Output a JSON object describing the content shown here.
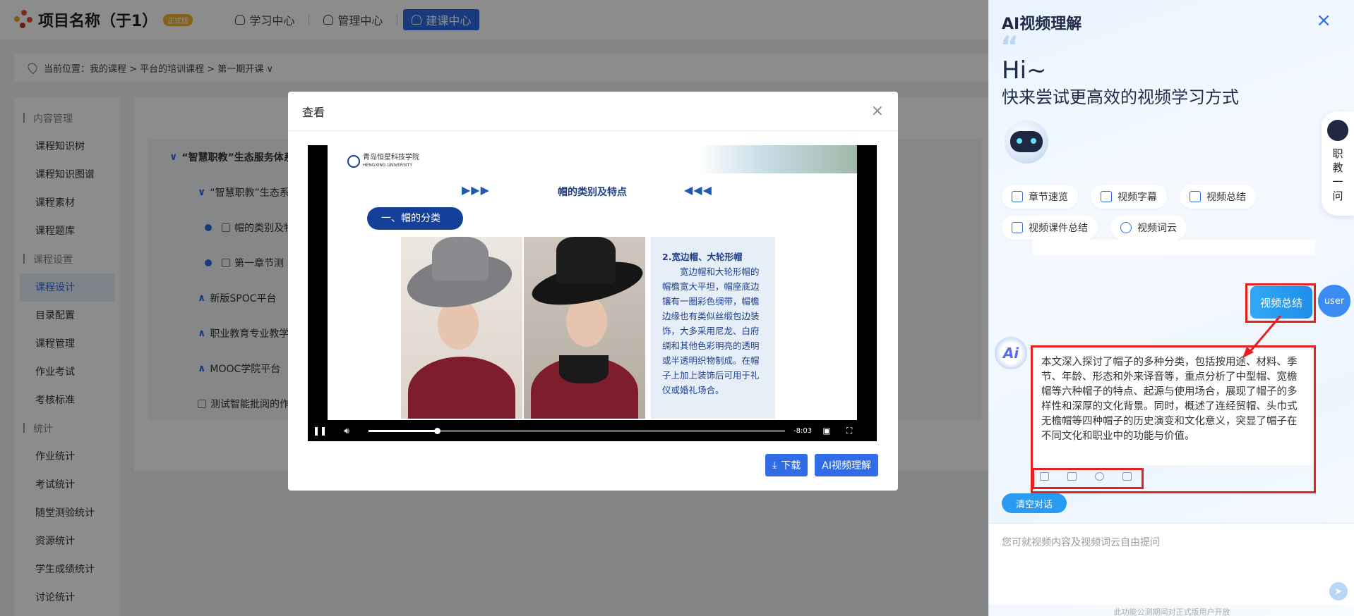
{
  "app": {
    "project_title": "项目名称（于1）",
    "badge": "正式版",
    "nav": [
      {
        "label": "学习中心"
      },
      {
        "label": "管理中心"
      },
      {
        "label": "建课中心"
      }
    ]
  },
  "breadcrumb": {
    "text": "当前位置：我的课程 > 平台的培训课程 > 第一期开课 ∨"
  },
  "sidebar": {
    "groups": [
      {
        "title": "内容管理",
        "items": [
          "课程知识树",
          "课程知识图谱",
          "课程素材",
          "课程题库"
        ]
      },
      {
        "title": "课程设置",
        "items": [
          "课程设计",
          "目录配置",
          "课程管理",
          "作业考试",
          "考核标准"
        ]
      },
      {
        "title": "统计",
        "items": [
          "作业统计",
          "考试统计",
          "随堂测验统计",
          "资源统计",
          "学生成绩统计",
          "讨论统计"
        ]
      }
    ],
    "active_item": "课程设计"
  },
  "tree": {
    "rows": [
      {
        "caret": "∨",
        "label": "“智慧职教”生态服务体系"
      },
      {
        "caret": "∨",
        "label": "“智慧职教”生态系统"
      },
      {
        "label": "帽的类别及特"
      },
      {
        "label": "第一章节测"
      },
      {
        "caret": "∧",
        "label": "新版SPOC平台"
      },
      {
        "caret": "∧",
        "label": "职业教育专业教学"
      },
      {
        "caret": "∧",
        "label": "MOOC学院平台"
      },
      {
        "label": "测试智能批阅的作"
      }
    ]
  },
  "modal": {
    "title": "查看",
    "close": "×",
    "slide": {
      "school": "青岛恒星科技学院",
      "school_en": "HENGXING UNIVERSITY",
      "arrows_left": "▶▶▶",
      "heading": "帽的类别及特点",
      "arrows_right": "◀◀◀",
      "section": "一、帽的分类",
      "text_title": "2.宽边帽、大轮形帽",
      "text_body": "　　宽边帽和大轮形帽的帽檐宽大平坦，帽座底边镶有一圈彩色绸带，帽檐边缘也有类似丝缎包边装饰，大多采用尼龙、白府绸和其他色彩明亮的透明或半透明织物制成。在帽子上加上装饰后可用于礼仪或婚礼场合。"
    },
    "player": {
      "time_remaining": "-8:03",
      "progress_percent": 16.5
    },
    "download_label": "下载",
    "ai_button_label": "AI视频理解"
  },
  "ai_panel": {
    "title": "AI视频理解",
    "close": "×",
    "greeting": "Hi~",
    "slogan": "快来尝试更高效的视频学习方式",
    "side_bot_text": [
      "职",
      "教",
      "一",
      "问"
    ],
    "features_row1": [
      "章节速览",
      "视频字幕",
      "视频总结"
    ],
    "features_row2": [
      "视频课件总结",
      "视频词云"
    ],
    "user_message": "视频总结",
    "user_avatar": "user",
    "ai_avatar": "Ai",
    "ai_reply": "本文深入探讨了帽子的多种分类，包括按用途、材料、季节、年龄、形态和外来译音等，重点分析了中型帽、宽檐帽等六种帽子的特点、起源与使用场合，展现了帽子的多样性和深厚的文化背景。同时，概述了连经贸帽、头巾式无檐帽等四种帽子的历史演变和文化意义，突显了帽子在不同文化和职业中的功能与价值。",
    "clear_label": "清空对话",
    "input_placeholder": "您可就视频内容及视频词云自由提问",
    "notice": "此功能公测期间对正式版用户开放"
  }
}
